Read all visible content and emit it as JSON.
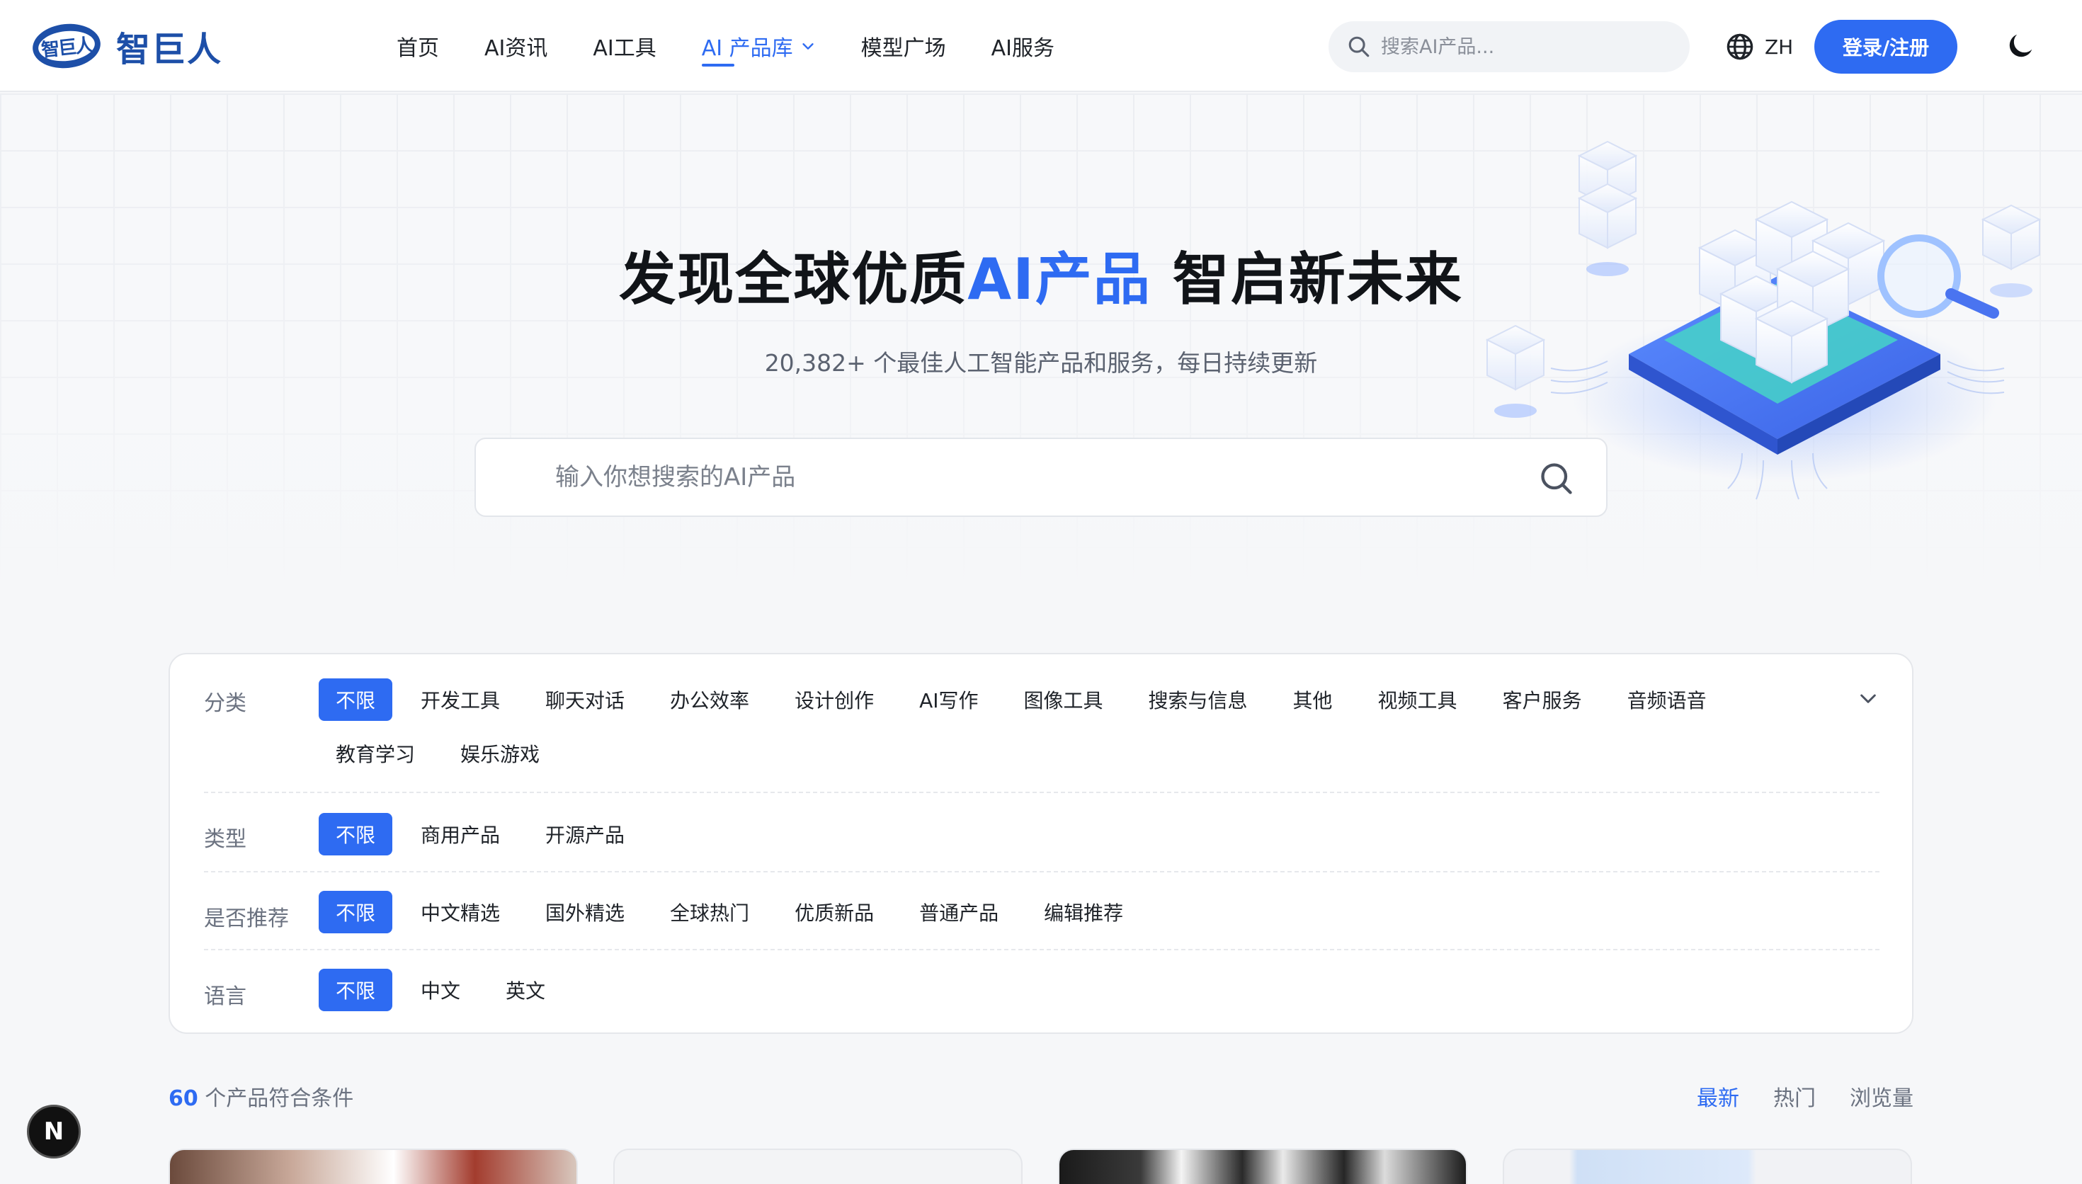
{
  "brand": {
    "name": "智巨人",
    "badge": "智巨人"
  },
  "nav": {
    "items": [
      {
        "label": "首页",
        "active": false
      },
      {
        "label": "AI资讯",
        "active": false
      },
      {
        "label": "AI工具",
        "active": false
      },
      {
        "label": "AI 产品库",
        "active": true
      },
      {
        "label": "模型广场",
        "active": false
      },
      {
        "label": "AI服务",
        "active": false
      }
    ],
    "search_placeholder": "搜索AI产品...",
    "lang": "ZH",
    "login": "登录/注册"
  },
  "hero": {
    "title_pre": "发现全球优质",
    "title_hl": "AI产品",
    "title_post": " 智启新未来",
    "subtitle": "20,382+ 个最佳人工智能产品和服务，每日持续更新",
    "search_placeholder": "输入你想搜索的AI产品"
  },
  "filters": {
    "category": {
      "label": "分类",
      "options": [
        "不限",
        "开发工具",
        "聊天对话",
        "办公效率",
        "设计创作",
        "AI写作",
        "图像工具",
        "搜索与信息",
        "其他",
        "视频工具",
        "客户服务",
        "音频语音",
        "教育学习",
        "娱乐游戏"
      ],
      "selected": 0
    },
    "type": {
      "label": "类型",
      "options": [
        "不限",
        "商用产品",
        "开源产品"
      ],
      "selected": 0
    },
    "recommend": {
      "label": "是否推荐",
      "options": [
        "不限",
        "中文精选",
        "国外精选",
        "全球热门",
        "优质新品",
        "普通产品",
        "编辑推荐"
      ],
      "selected": 0
    },
    "language": {
      "label": "语言",
      "options": [
        "不限",
        "中文",
        "英文"
      ],
      "selected": 0
    }
  },
  "results": {
    "count": "60",
    "text": " 个产品符合条件",
    "sorts": [
      {
        "label": "最新",
        "active": true
      },
      {
        "label": "热门",
        "active": false
      },
      {
        "label": "浏览量",
        "active": false
      }
    ]
  },
  "dev_badge": "N",
  "colors": {
    "accent": "#2e6bf2",
    "brand": "#1d4fa8"
  }
}
